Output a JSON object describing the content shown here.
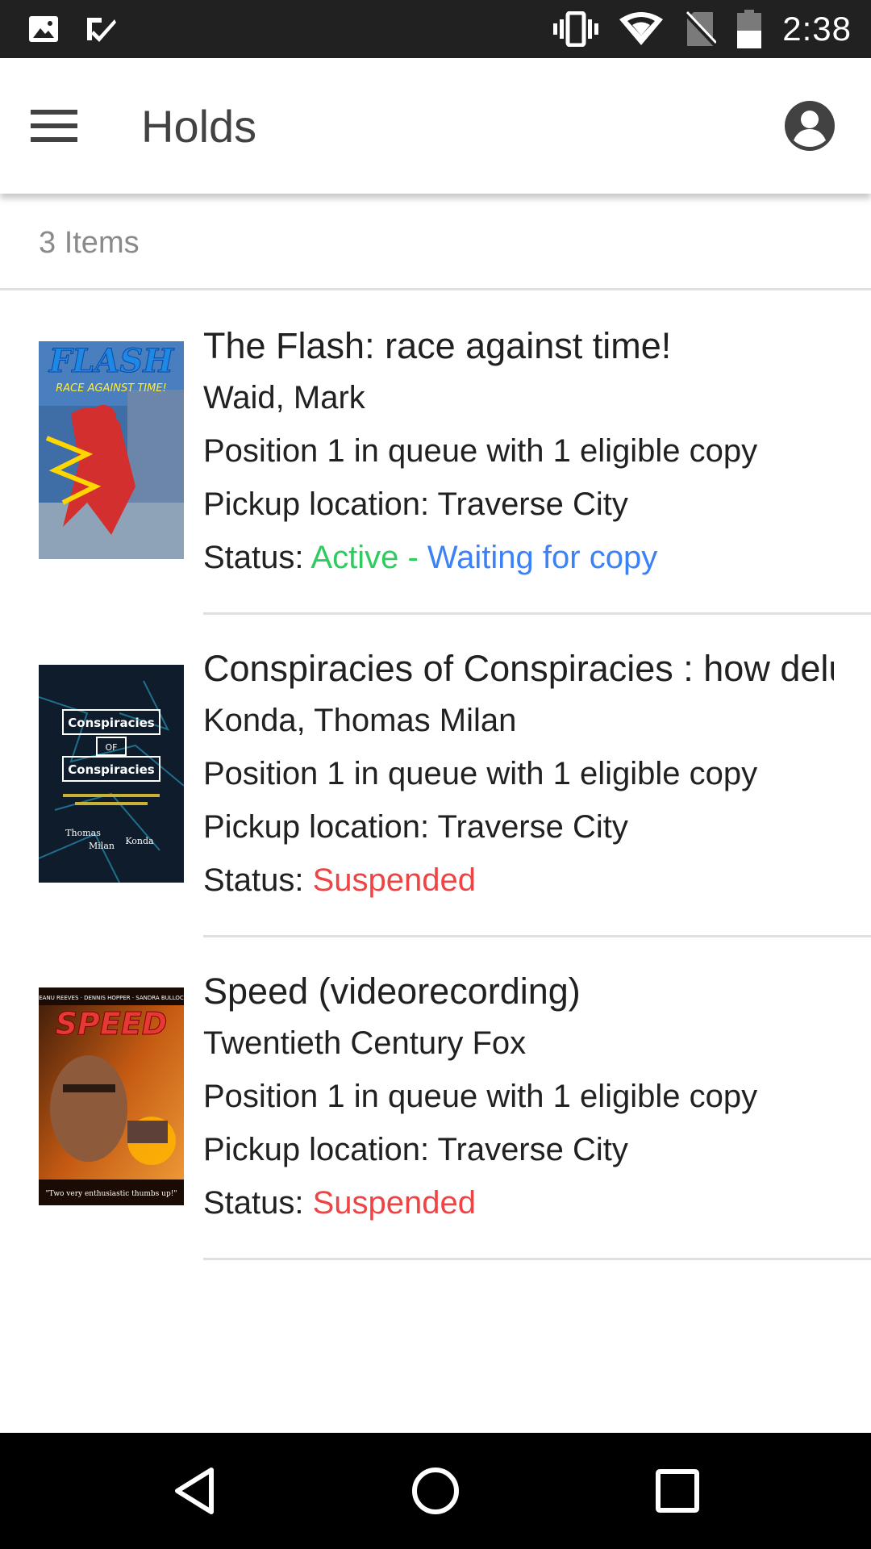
{
  "status_bar": {
    "time": "2:38",
    "left_icons": [
      "image-icon",
      "check-notification-icon"
    ],
    "right_icons": [
      "vibrate-icon",
      "wifi-icon",
      "no-sim-icon",
      "battery-icon"
    ]
  },
  "app_bar": {
    "title": "Holds",
    "menu_icon": "hamburger-menu-icon",
    "account_icon": "account-circle-icon"
  },
  "list_header": {
    "count": "3 Items"
  },
  "holds": [
    {
      "title": "The Flash: race against time!",
      "author": "Waid, Mark",
      "queue": "Position 1 in queue with 1 eligible copy",
      "pickup": "Pickup location: Traverse City",
      "status_label": "Status: ",
      "status_primary": "Active - ",
      "status_secondary": "Waiting for copy",
      "status_primary_color": "#2ecc5f",
      "status_secondary_color": "#3b82f6",
      "cover_text": "FLASH"
    },
    {
      "title": "Conspiracies of Conspiracies : how delusions have overrun America",
      "author": "Konda, Thomas Milan",
      "queue": "Position 1 in queue with 1 eligible copy",
      "pickup": "Pickup location: Traverse City",
      "status_label": "Status: ",
      "status_primary": "Suspended",
      "status_primary_color": "#ef4444",
      "cover_lines": [
        "Conspiracies",
        "OF",
        "Conspiracies",
        "Thomas",
        "Milan",
        "Konda"
      ]
    },
    {
      "title": "Speed (videorecording)",
      "author": "Twentieth Century Fox",
      "queue": "Position 1 in queue with 1 eligible copy",
      "pickup": "Pickup location: Traverse City",
      "status_label": "Status: ",
      "status_primary": "Suspended",
      "status_primary_color": "#ef4444",
      "cover_text": "SPEED"
    }
  ],
  "nav_bar": {
    "icons": [
      "back-icon",
      "home-icon",
      "recents-icon"
    ]
  }
}
